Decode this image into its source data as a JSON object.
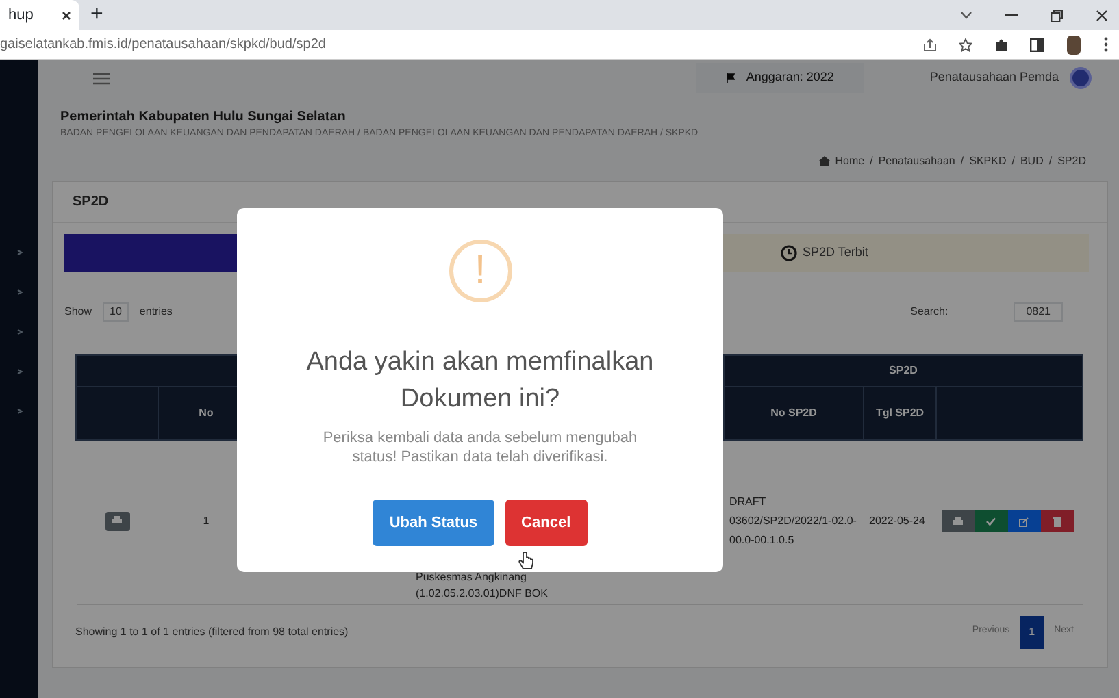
{
  "browser": {
    "tab_title": "hup",
    "new_tab": "+",
    "url": "gaiselatankab.fmis.id/penatausahaan/skpkd/bud/sp2d"
  },
  "topbar": {
    "year": "Anggaran: 2022",
    "role": "Penatausahaan Pemda"
  },
  "header": {
    "title": "Pemerintah Kabupaten Hulu Sungai Selatan",
    "subtitle": "BADAN PENGELOLAAN KEUANGAN DAN PENDAPATAN DAERAH / BADAN PENGELOLAAN KEUANGAN DAN PENDAPATAN DAERAH / SKPKD",
    "separator": "/",
    "breadcrumb": [
      "Home",
      "Penatausahaan",
      "SKPKD",
      "BUD",
      "SP2D"
    ]
  },
  "card": {
    "title": "SP2D",
    "tabs": [
      {
        "selected": true
      },
      {
        "label": "SP2D Terbit",
        "selected": false
      }
    ],
    "length": {
      "before": "Show",
      "value": "10",
      "after": "entries"
    },
    "search": {
      "label": "Search:",
      "value": "0821"
    },
    "table": {
      "group_header": "SP2D",
      "columns": [
        "No",
        "No SP2D",
        "Tgl SP2D"
      ],
      "rows": [
        {
          "no": "1",
          "column_3": [
            "Puskesmas Angkinang",
            "(1.02.05.2.03.01)DNF BOK"
          ],
          "no_sp2d": "DRAFT 03602/SP2D/2022/1-02.0-00.0-00.1.0.5",
          "tgl": "2022-05-24",
          "actions": [
            {
              "kind": "print"
            },
            {
              "kind": "check"
            },
            {
              "kind": "edit"
            },
            {
              "kind": "delete"
            }
          ]
        }
      ]
    },
    "info": "Showing 1 to 1 of 1 entries (filtered from 98 total entries)",
    "pagination": [
      {
        "label": "Previous",
        "selected": false
      },
      {
        "label": "1",
        "selected": true
      },
      {
        "label": "Next",
        "selected": false
      }
    ]
  },
  "modal": {
    "icon": "!",
    "title": "Anda yakin akan memfinalkan Dokumen ini?",
    "text": "Periksa kembali data anda sebelum mengubah status! Pastikan data telah diverifikasi.",
    "buttons": [
      {
        "kind": "confirm",
        "label": "Ubah Status"
      },
      {
        "kind": "cancel",
        "label": "Cancel"
      }
    ]
  }
}
